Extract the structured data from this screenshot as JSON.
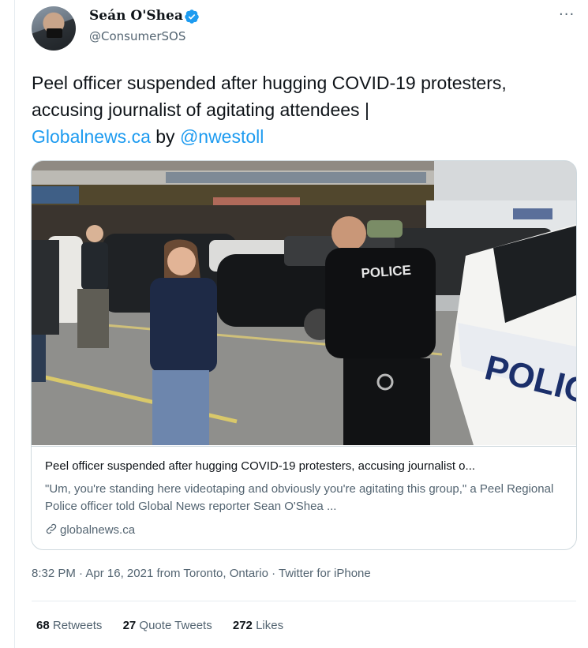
{
  "author": {
    "name": "Seán O'Shea",
    "handle": "@ConsumerSOS",
    "verified": true
  },
  "tweet": {
    "text_plain": "Peel officer suspended after hugging COVID-19 protesters, accusing journalist of agitating attendees |",
    "link_domain": "Globalnews.ca",
    "by_word": "by",
    "mention": "@nwestoll"
  },
  "card": {
    "title": "Peel officer suspended after hugging COVID-19 protesters, accusing journalist o...",
    "description": "\"Um, you're standing here videotaping and obviously you're agitating this group,\" a Peel Regional Police officer told Global News reporter Sean O'Shea ...",
    "domain": "globalnews.ca",
    "image_text": {
      "vest": "POLICE",
      "car": "POLICE"
    }
  },
  "meta": {
    "time": "8:32 PM",
    "separator": "·",
    "date": "Apr 16, 2021",
    "location": "from Toronto, Ontario",
    "client": "Twitter for iPhone"
  },
  "stats": {
    "retweets_count": "68",
    "retweets_label": "Retweets",
    "quote_count": "27",
    "quote_label": "Quote Tweets",
    "likes_count": "272",
    "likes_label": "Likes"
  },
  "colors": {
    "link": "#1d9bf0",
    "text": "#0f1419",
    "secondary": "#536471",
    "border": "#cfd9de"
  },
  "icons": [
    "verified-badge-icon",
    "more-options-icon",
    "link-icon"
  ]
}
